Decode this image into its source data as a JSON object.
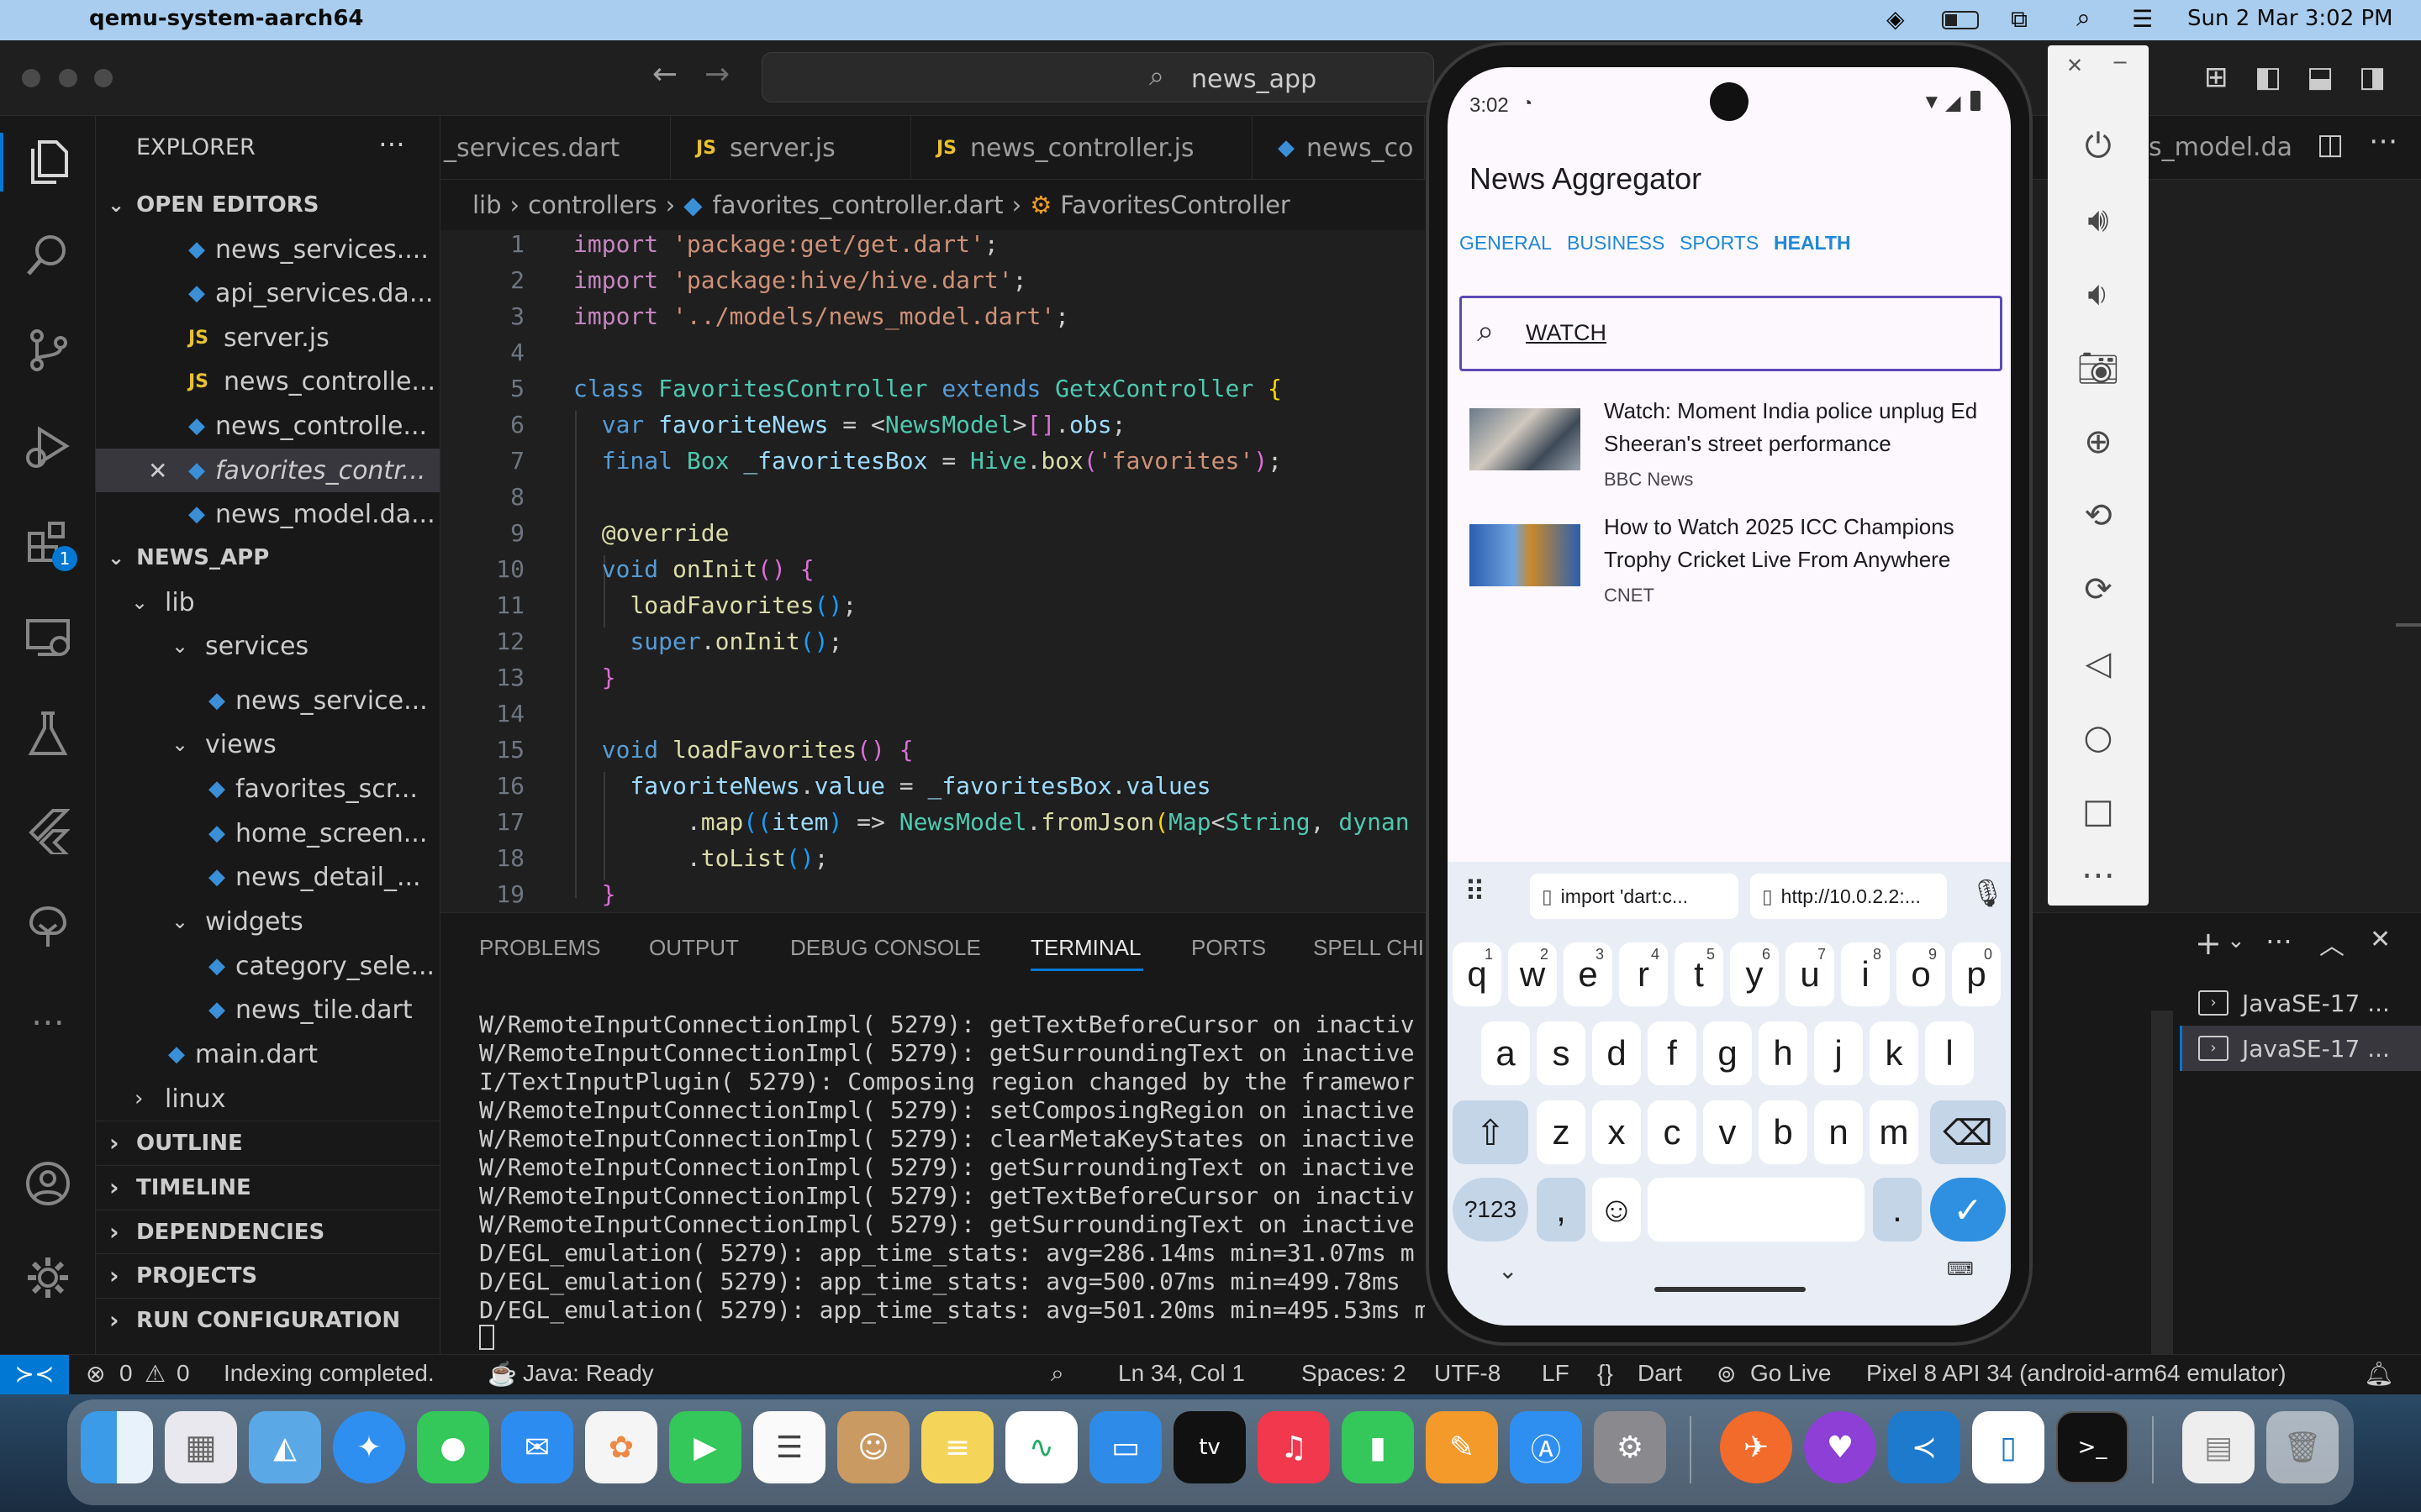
{
  "menubar": {
    "app": "qemu-system-aarch64",
    "clock": "Sun 2 Mar  3:02 PM"
  },
  "titlebar": {
    "search": "news_app"
  },
  "activity_badge": "1",
  "sidebar": {
    "title": "EXPLORER",
    "open_editors_label": "OPEN EDITORS",
    "open_editors": [
      {
        "name": "news_services....",
        "type": "dart"
      },
      {
        "name": "api_services.da...",
        "type": "dart"
      },
      {
        "name": "server.js",
        "type": "js"
      },
      {
        "name": "news_controlle...",
        "type": "js"
      },
      {
        "name": "news_controlle...",
        "type": "dart"
      },
      {
        "name": "favorites_contr...",
        "type": "dart"
      },
      {
        "name": "news_model.da...",
        "type": "dart"
      }
    ],
    "project_label": "NEWS_APP",
    "tree": {
      "lib": "lib",
      "services": "services",
      "news_service": "news_service...",
      "views": "views",
      "favorites_scr": "favorites_scr...",
      "home_screen": "home_screen...",
      "news_detail": "news_detail_...",
      "widgets": "widgets",
      "category_sele": "category_sele...",
      "news_tile": "news_tile.dart",
      "main": "main.dart",
      "linux": "linux"
    },
    "sections": [
      "OUTLINE",
      "TIMELINE",
      "DEPENDENCIES",
      "PROJECTS",
      "RUN CONFIGURATION"
    ]
  },
  "tabs": [
    "_services.dart",
    "server.js",
    "news_controller.js",
    "news_co",
    "s_model.da"
  ],
  "breadcrumb": {
    "a": "lib",
    "b": "controllers",
    "c": "favorites_controller.dart",
    "d": "FavoritesController"
  },
  "code": {
    "line_numbers": [
      "1",
      "2",
      "3",
      "4",
      "5",
      "6",
      "7",
      "8",
      "9",
      "10",
      "11",
      "12",
      "13",
      "14",
      "15",
      "16",
      "17",
      "18",
      "19"
    ],
    "l1a": "import ",
    "l1b": "'package:get/get.dart'",
    "l2a": "import ",
    "l2b": "'package:hive/hive.dart'",
    "l3a": "import ",
    "l3b": "'../models/news_model.dart'",
    "l5a": "class ",
    "l5b": "FavoritesController ",
    "l5c": "extends ",
    "l5d": "GetxController ",
    "l6a": "var ",
    "l6b": "favoriteNews",
    " l6c": "",
    "l6d": "NewsModel",
    "l6e": "obs",
    "l7a": "final ",
    "l7b": "Box ",
    "l7c": "_favoritesBox",
    " l7d": "",
    "l7e": "Hive",
    "l7f": "box",
    "l7g": "'favorites'",
    "l9": "@override",
    "l10a": "void ",
    "l10b": "onInit",
    "l11": "loadFavorites",
    "l12a": "super",
    "l12b": "onInit",
    "l15a": "void ",
    "l15b": "loadFavorites",
    "l16a": "favoriteNews",
    "l16b": "value",
    "l16c": "_favoritesBox",
    "l16d": "values",
    "l17a": "map",
    "l17b": "item",
    "l17c": "NewsModel",
    "l17d": "fromJson",
    "l17e": "Map",
    "l17f": "String",
    "l17g": "dynan",
    "l18": "toList"
  },
  "panel": {
    "tabs": [
      "PROBLEMS",
      "OUTPUT",
      "DEBUG CONSOLE",
      "TERMINAL",
      "PORTS",
      "SPELL CHI"
    ],
    "terminal_lines": [
      "W/RemoteInputConnectionImpl( 5279): getTextBeforeCursor on inactiv",
      "W/RemoteInputConnectionImpl( 5279): getSurroundingText on inactive",
      "I/TextInputPlugin( 5279): Composing region changed by the framewor",
      "W/RemoteInputConnectionImpl( 5279): setComposingRegion on inactive",
      "W/RemoteInputConnectionImpl( 5279): clearMetaKeyStates on inactive",
      "W/RemoteInputConnectionImpl( 5279): getSurroundingText on inactive",
      "W/RemoteInputConnectionImpl( 5279): getTextBeforeCursor on inactiv",
      "W/RemoteInputConnectionImpl( 5279): getSurroundingText on inactive",
      "D/EGL_emulation( 5279): app_time_stats: avg=286.14ms min=31.07ms m",
      "D/EGL_emulation( 5279): app_time_stats: avg=500.07ms min=499.78ms",
      "D/EGL_emulation( 5279): app_time_stats: avg=501.20ms min=495.53ms m"
    ],
    "terminals": [
      "JavaSE-17 ...",
      "JavaSE-17 ..."
    ]
  },
  "status": {
    "errors": "0",
    "warnings": "0",
    "indexing": "Indexing completed.",
    "java": "Java: Ready",
    "position": "Ln 34, Col 1",
    "spaces": "Spaces: 2",
    "encoding": "UTF-8",
    "eol": "LF",
    "language": "Dart",
    "golive": "Go Live",
    "device": "Pixel 8 API 34 (android-arm64 emulator)"
  },
  "phone": {
    "time": "3:02",
    "app_title": "News Aggregator",
    "categories": [
      "GENERAL",
      "BUSINESS",
      "SPORTS",
      "HEALTH"
    ],
    "selected_category": "HEALTH",
    "search_value": "WATCH",
    "articles": [
      {
        "title": "Watch: Moment India police unplug Ed Sheeran's street performance",
        "source": "BBC News"
      },
      {
        "title": "How to Watch 2025 ICC Champions Trophy Cricket Live From Anywhere",
        "source": "CNET"
      }
    ],
    "clipboard": [
      "import 'dart:c...",
      "http://10.0.2.2:..."
    ],
    "keyboard": {
      "row1": [
        "q",
        "w",
        "e",
        "r",
        "t",
        "y",
        "u",
        "i",
        "o",
        "p"
      ],
      "row1_hints": [
        "1",
        "2",
        "3",
        "4",
        "5",
        "6",
        "7",
        "8",
        "9",
        "0"
      ],
      "row2": [
        "a",
        "s",
        "d",
        "f",
        "g",
        "h",
        "j",
        "k",
        "l"
      ],
      "row3": [
        "z",
        "x",
        "c",
        "v",
        "b",
        "n",
        "m"
      ],
      "symbols": "?123",
      "comma": ",",
      "period": "."
    }
  },
  "colors": {
    "accent": "#0078d4",
    "link": "#1f88d6",
    "statusbar_remote": "#0078d4",
    "phone_bg": "#fdf8fd",
    "keyboard_bg": "#e9eef6"
  }
}
